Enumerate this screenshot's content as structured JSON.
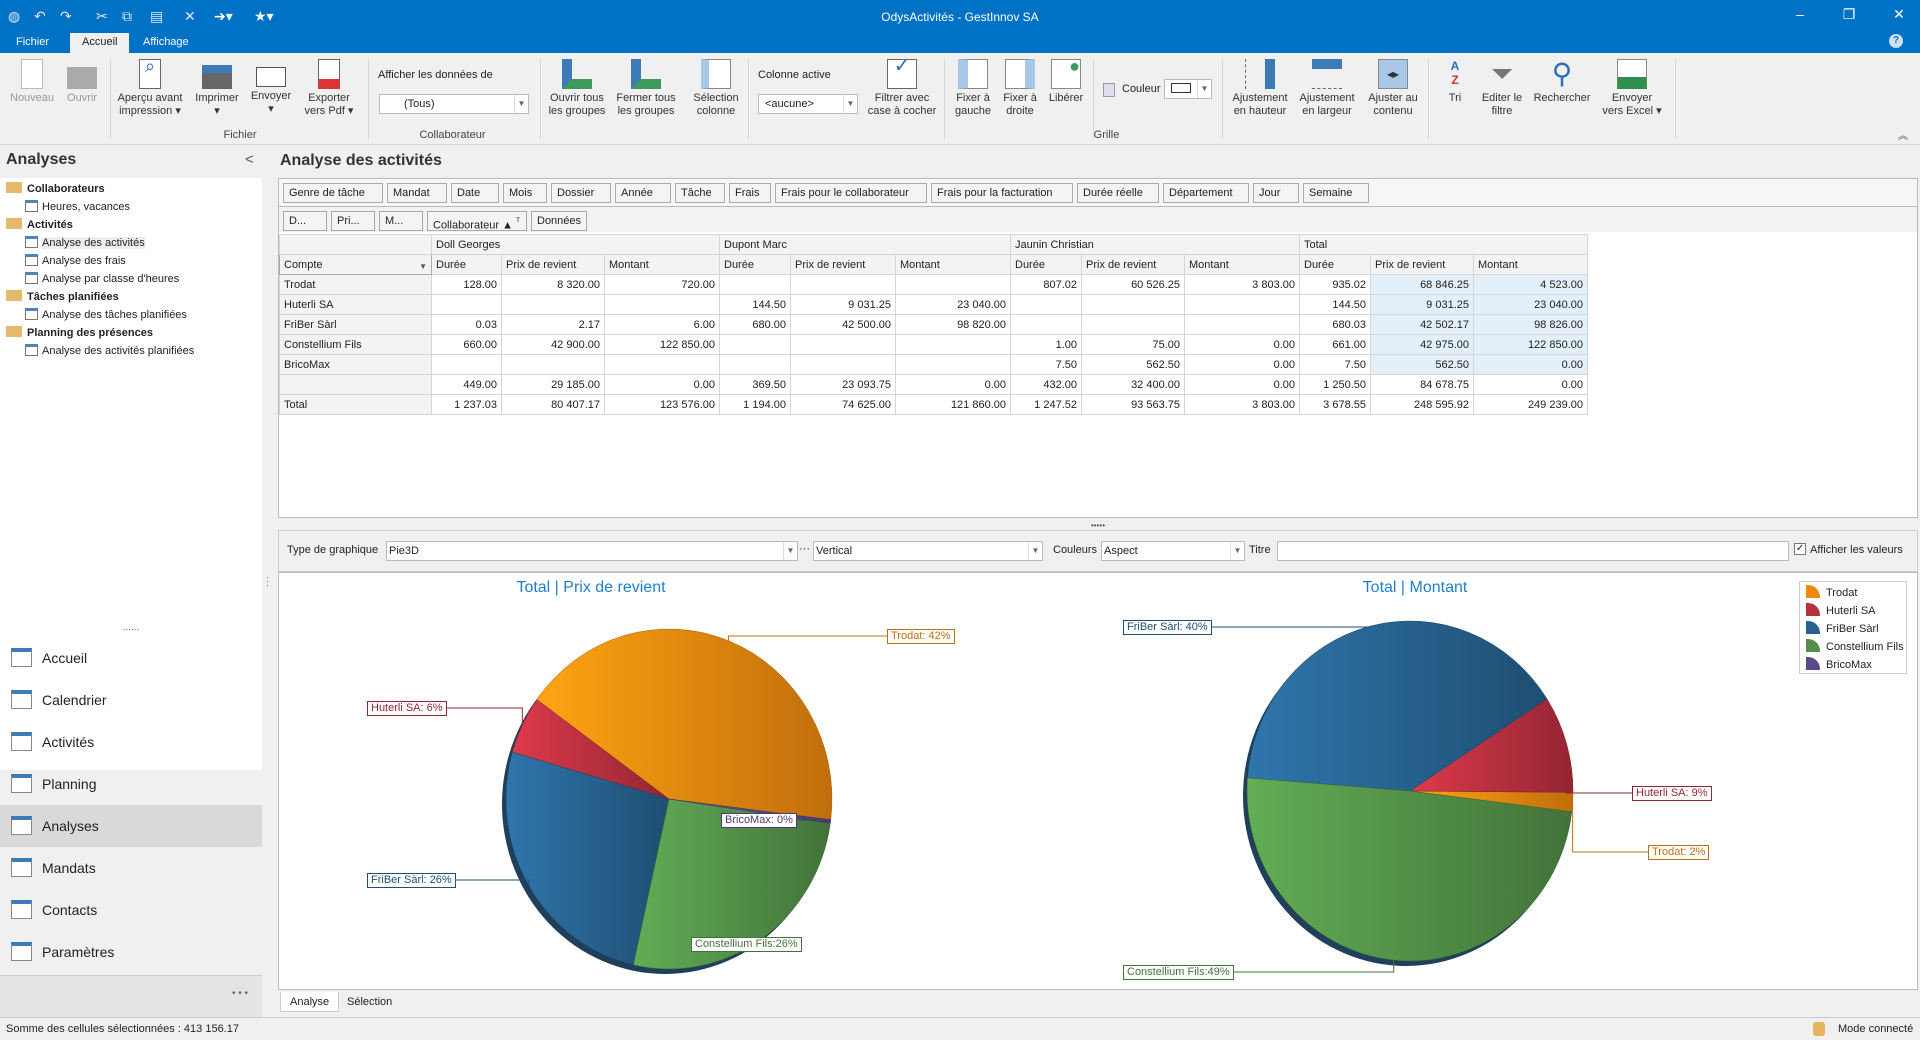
{
  "window": {
    "title": "OdysActivités - GestInnov SA",
    "minimize": "–",
    "restore": "❐",
    "close": "✕",
    "help": "?"
  },
  "quick_access": {
    "icons": [
      "app-globe-icon",
      "undo-icon",
      "redo-icon",
      "cut-icon",
      "copy-icon",
      "paste-icon",
      "delete-icon",
      "arrow-icon",
      "star-icon"
    ]
  },
  "ribbon_tabs": [
    {
      "label": "Fichier"
    },
    {
      "label": "Accueil",
      "active": true
    },
    {
      "label": "Affichage"
    }
  ],
  "ribbon": {
    "nouveau": "Nouveau",
    "ouvrir": "Ouvrir",
    "apercu": "Aperçu avant",
    "apercu2": "impression ▾",
    "imprimer": "Imprimer",
    "imprimer2": "▾",
    "envoyer": "Envoyer",
    "envoyer2": "▾",
    "exporter": "Exporter",
    "exporter2": "vers Pdf ▾",
    "group_fichier": "Fichier",
    "afficher_label": "Afficher les données de",
    "afficher_value": "(Tous)",
    "group_collaborateur": "Collaborateur",
    "ouvrir_tous": "Ouvrir tous",
    "ouvrir_tous2": "les groupes",
    "fermer_tous": "Fermer tous",
    "fermer_tous2": "les groupes",
    "selection": "Sélection",
    "selection2": "colonne",
    "colonne_active_label": "Colonne active",
    "colonne_active_value": "<aucune>",
    "filtrer": "Filtrer avec",
    "filtrer2": "case à cocher",
    "fixer_gauche": "Fixer à",
    "fixer_gauche2": "gauche",
    "fixer_droite": "Fixer à",
    "fixer_droite2": "droite",
    "liberer": "Libérer",
    "couleur": "Couleur",
    "ajust_hauteur": "Ajustement",
    "ajust_hauteur2": "en hauteur",
    "ajust_largeur": "Ajustement",
    "ajust_largeur2": "en largeur",
    "ajuster_contenu": "Ajuster au",
    "ajuster_contenu2": "contenu",
    "tri": "Tri",
    "editer": "Editer le",
    "editer2": "filtre",
    "rechercher": "Rechercher",
    "envoyer_excel": "Envoyer",
    "envoyer_excel2": "vers Excel ▾",
    "group_grille": "Grille",
    "collapse": "︽"
  },
  "sidebar": {
    "title": "Analyses",
    "collapse": "<",
    "tree": [
      {
        "label": "Collaborateurs",
        "type": "folder"
      },
      {
        "label": "Heures, vacances",
        "type": "item"
      },
      {
        "label": "Activités",
        "type": "folder"
      },
      {
        "label": "Analyse des activités",
        "type": "item",
        "selected": true
      },
      {
        "label": "Analyse des frais",
        "type": "item"
      },
      {
        "label": "Analyse par classe d'heures",
        "type": "item"
      },
      {
        "label": "Tâches planifiées",
        "type": "folder"
      },
      {
        "label": "Analyse des tâches planifiées",
        "type": "item"
      },
      {
        "label": "Planning des présences",
        "type": "folder"
      },
      {
        "label": "Analyse des activités planifiées",
        "type": "item"
      }
    ],
    "splitter": "......",
    "nav": [
      {
        "label": "Accueil",
        "icon": "home-icon"
      },
      {
        "label": "Calendrier",
        "icon": "calendar-icon"
      },
      {
        "label": "Activités",
        "icon": "activities-icon"
      },
      {
        "label": "Planning",
        "icon": "planning-icon"
      },
      {
        "label": "Analyses",
        "icon": "analyses-icon",
        "active": true
      },
      {
        "label": "Mandats",
        "icon": "mandates-icon"
      },
      {
        "label": "Contacts",
        "icon": "contacts-icon"
      },
      {
        "label": "Paramètres",
        "icon": "settings-icon"
      }
    ],
    "more": "• • •"
  },
  "main": {
    "title": "Analyse des activités",
    "filter_fields": [
      "Genre de tâche",
      "Mandat",
      "Date",
      "Mois",
      "Dossier",
      "Année",
      "Tâche",
      "Frais",
      "Frais pour le collaborateur",
      "Frais pour la facturation",
      "Durée réelle",
      "Département",
      "Jour",
      "Semaine"
    ],
    "data_fields": [
      "D...",
      "Pri...",
      "M..."
    ],
    "column_field": "Collaborateur ▲",
    "column_filter_icon": "ᵀ",
    "data_header": "Données",
    "row_field": "Compte",
    "collaborators": [
      "Doll Georges",
      "Dupont Marc",
      "Jaunin Christian",
      "Total"
    ],
    "measures": [
      "Durée",
      "Prix de revient",
      "Montant"
    ],
    "rows": [
      {
        "label": "Trodat",
        "values": [
          "128.00",
          "8 320.00",
          "720.00",
          "",
          "",
          "",
          "807.02",
          "60 526.25",
          "3 803.00",
          "935.02",
          "68 846.25",
          "4 523.00"
        ]
      },
      {
        "label": "Huterli SA",
        "values": [
          "",
          "",
          "",
          "144.50",
          "9 031.25",
          "23 040.00",
          "",
          "",
          "",
          "144.50",
          "9 031.25",
          "23 040.00"
        ]
      },
      {
        "label": "FriBer Sàrl",
        "values": [
          "0.03",
          "2.17",
          "6.00",
          "680.00",
          "42 500.00",
          "98 820.00",
          "",
          "",
          "",
          "680.03",
          "42 502.17",
          "98 826.00"
        ]
      },
      {
        "label": "Constellium Fils",
        "values": [
          "660.00",
          "42 900.00",
          "122 850.00",
          "",
          "",
          "",
          "1.00",
          "75.00",
          "0.00",
          "661.00",
          "42 975.00",
          "122 850.00"
        ]
      },
      {
        "label": "BricoMax",
        "values": [
          "",
          "",
          "",
          "",
          "",
          "",
          "7.50",
          "562.50",
          "0.00",
          "7.50",
          "562.50",
          "0.00"
        ]
      },
      {
        "label": "",
        "values": [
          "449.00",
          "29 185.00",
          "0.00",
          "369.50",
          "23 093.75",
          "0.00",
          "432.00",
          "32 400.00",
          "0.00",
          "1 250.50",
          "84 678.75",
          "0.00"
        ]
      },
      {
        "label": "Total",
        "values": [
          "1 237.03",
          "80 407.17",
          "123 576.00",
          "1 194.00",
          "74 625.00",
          "121 860.00",
          "1 247.52",
          "93 563.75",
          "3 803.00",
          "3 678.55",
          "248 595.92",
          "249 239.00"
        ]
      }
    ],
    "splitter": "•••••"
  },
  "chart_toolbar": {
    "type_label": "Type de graphique",
    "type_value": "Pie3D",
    "more": "···",
    "orientation": "Vertical",
    "colors_label": "Couleurs",
    "colors_value": "Aspect",
    "title_label": "Titre",
    "title_value": "",
    "show_values": "Afficher les valeurs",
    "show_values_checked": true
  },
  "chart_data": [
    {
      "type": "pie",
      "title": "Total | Prix de revient",
      "categories": [
        "Trodat",
        "Huterli SA",
        "FriBer Sàrl",
        "Constellium Fils",
        "BricoMax"
      ],
      "values": [
        68846.25,
        9031.25,
        42502.17,
        42975.0,
        562.5
      ],
      "labels": [
        "Trodat: 42%",
        "Huterli SA: 6%",
        "FriBer Sàrl: 26%",
        "Constellium Fils:26%",
        "BricoMax: 0%"
      ]
    },
    {
      "type": "pie",
      "title": "Total | Montant",
      "categories": [
        "Trodat",
        "Huterli SA",
        "FriBer Sàrl",
        "Constellium Fils",
        "BricoMax"
      ],
      "values": [
        4523.0,
        23040.0,
        98826.0,
        122850.0,
        0.0
      ],
      "labels": [
        "Trodat: 2%",
        "Huterli SA: 9%",
        "FriBer Sàrl: 40%",
        "Constellium Fils:49%",
        ""
      ],
      "legend": "top-right"
    }
  ],
  "colors": {
    "Trodat": "#f0890f",
    "Huterli SA": "#b8303f",
    "FriBer Sàrl": "#27628f",
    "Constellium Fils": "#529048",
    "BricoMax": "#5a4a8c",
    "accent": "#0072c6"
  },
  "bottom_tabs": [
    {
      "label": "Analyse",
      "active": true
    },
    {
      "label": "Sélection"
    }
  ],
  "status": {
    "sum": "Somme des cellules sélectionnées : 413 156.17",
    "mode": "Mode connecté"
  }
}
